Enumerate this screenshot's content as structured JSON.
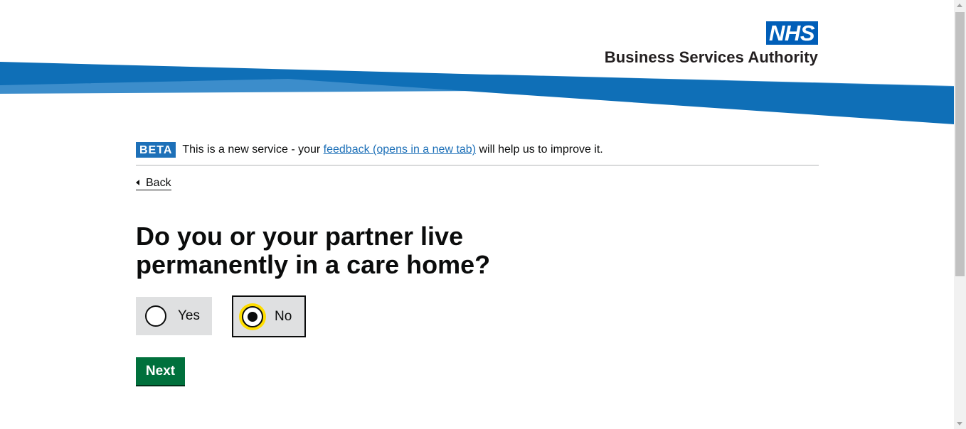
{
  "header": {
    "logo_mark": "NHS",
    "org_name": "Business Services Authority",
    "colors": {
      "nhs_blue": "#005eb8",
      "swoosh_dark": "#0f6fb7",
      "swoosh_light": "#3c8dcb"
    }
  },
  "beta_banner": {
    "tag": "BETA",
    "text_before": "This is a new service - your ",
    "link_text": "feedback (opens in a new tab)",
    "text_after": " will help us to improve it."
  },
  "back_link": {
    "label": "Back",
    "icon": "chevron-left-icon"
  },
  "question": {
    "title": "Do you or your partner live permanently in a care home?",
    "options": [
      {
        "label": "Yes",
        "selected": false
      },
      {
        "label": "No",
        "selected": true
      }
    ]
  },
  "next_button": {
    "label": "Next",
    "color": "#00703c"
  }
}
